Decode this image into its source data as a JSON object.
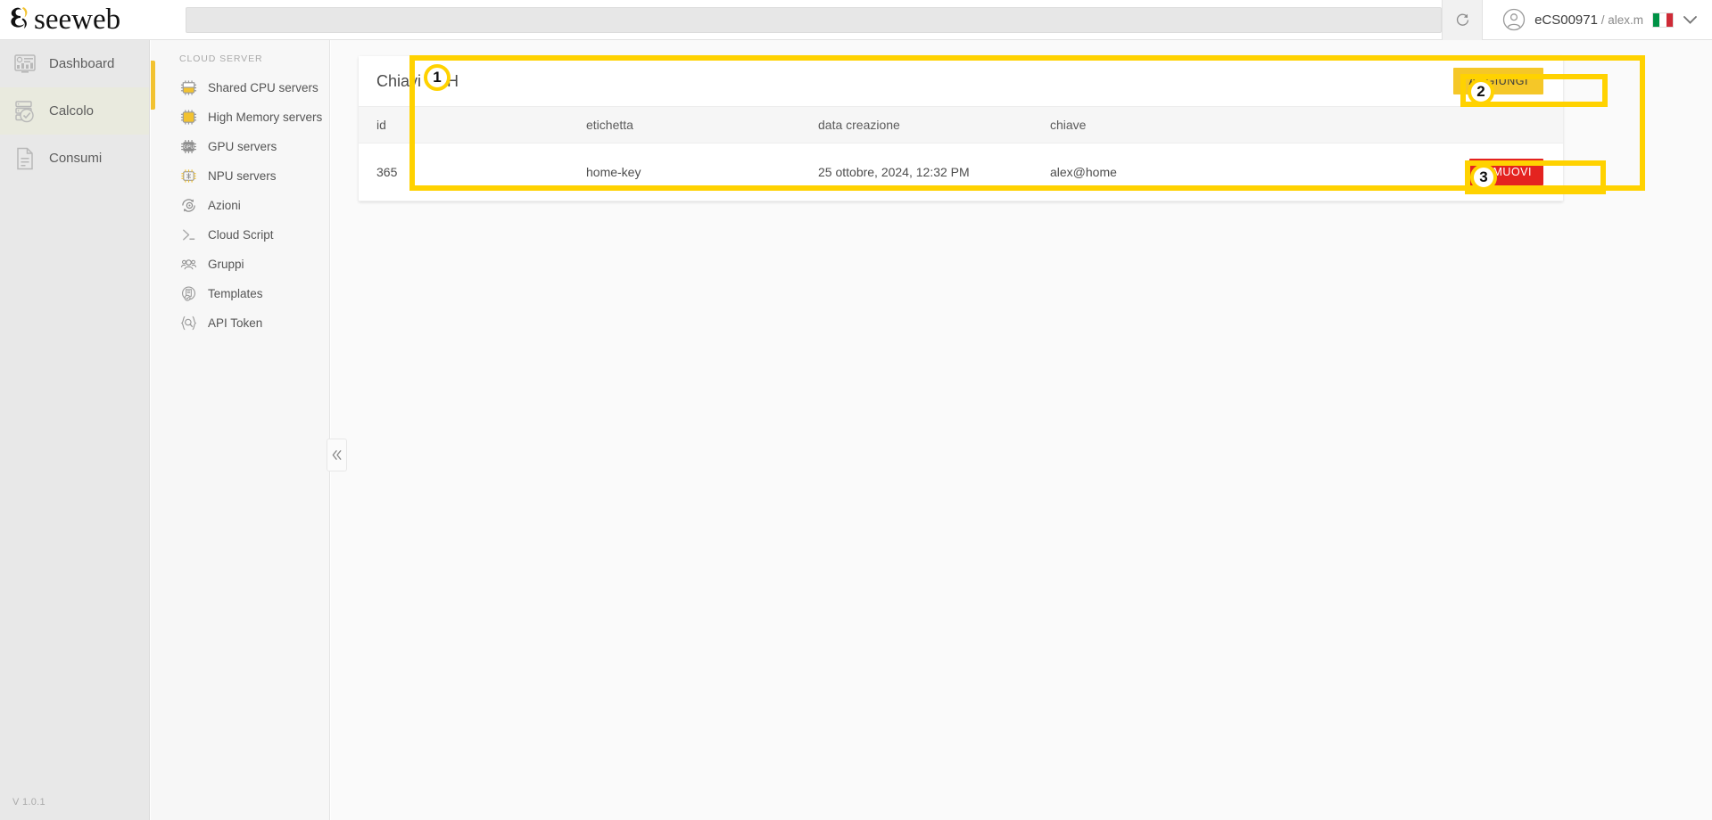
{
  "app": {
    "logo_text": "seeweb",
    "version": "V 1.0.1"
  },
  "header": {
    "search_placeholder": "",
    "search_value": "",
    "refresh_icon": "refresh-icon",
    "avatar_icon": "user-avatar-icon",
    "account_id": "eCS00971",
    "account_separator": " / ",
    "account_user": "alex.m",
    "flag_icon": "italy-flag-icon",
    "flag_colors": [
      "#009246",
      "#ffffff",
      "#ce2b37"
    ],
    "chevron_icon": "chevron-down-icon"
  },
  "sidebar_primary": {
    "items": [
      {
        "label": "Dashboard",
        "icon": "dashboard-icon",
        "active": false
      },
      {
        "label": "Calcolo",
        "icon": "server-check-icon",
        "active": true
      },
      {
        "label": "Consumi",
        "icon": "document-icon",
        "active": false
      }
    ]
  },
  "sidebar_secondary": {
    "section_title": "CLOUD SERVER",
    "items": [
      {
        "label": "Shared CPU servers",
        "icon": "cpu-chip-half-icon"
      },
      {
        "label": "High Memory servers",
        "icon": "cpu-chip-full-icon"
      },
      {
        "label": "GPU servers",
        "icon": "gpu-chip-icon"
      },
      {
        "label": "NPU servers",
        "icon": "npu-chip-icon"
      },
      {
        "label": "Azioni",
        "icon": "gear-refresh-icon"
      },
      {
        "label": "Cloud Script",
        "icon": "terminal-icon"
      },
      {
        "label": "Gruppi",
        "icon": "users-group-icon"
      },
      {
        "label": "Templates",
        "icon": "template-check-icon"
      },
      {
        "label": "API Token",
        "icon": "api-token-icon"
      }
    ],
    "collapse_icon": "double-chevron-left-icon"
  },
  "main": {
    "card_title": "Chiavi SSH",
    "add_button": "AGGIUNGI",
    "table": {
      "columns": [
        "id",
        "etichetta",
        "data creazione",
        "chiave",
        ""
      ],
      "rows": [
        {
          "id": "365",
          "etichetta": "home-key",
          "data_creazione": "25 ottobre, 2024, 12:32 PM",
          "chiave": "alex@home",
          "action": "RIMUOVI"
        }
      ]
    }
  },
  "annotations": {
    "color": "#ffd200",
    "markers": [
      {
        "number": "1",
        "target": "ssh-keys-card"
      },
      {
        "number": "2",
        "target": "add-button"
      },
      {
        "number": "3",
        "target": "remove-button"
      }
    ]
  }
}
